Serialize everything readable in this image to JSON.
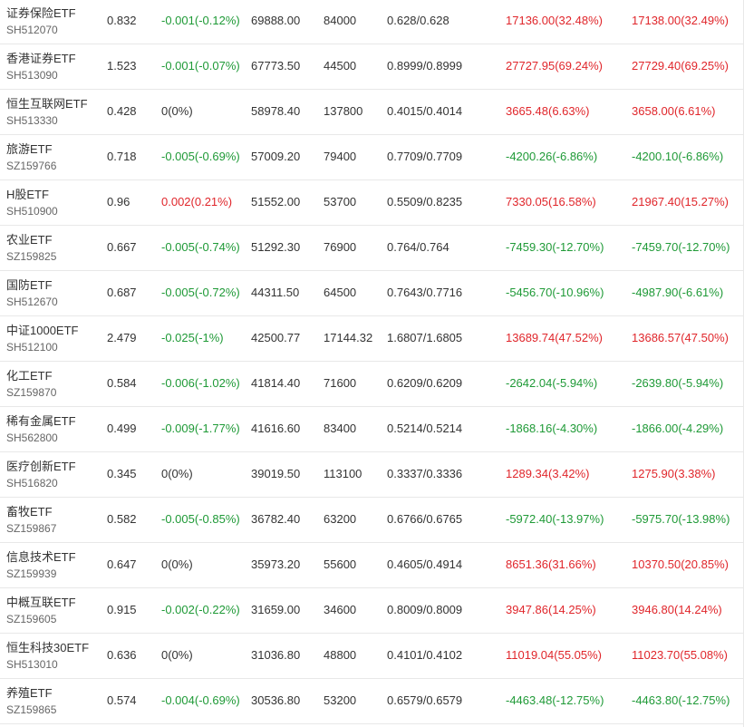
{
  "colors": {
    "up": "#e0262b",
    "down": "#1f9a37",
    "flat": "#333333",
    "code": "#666666",
    "divider": "#e8e8e8"
  },
  "rows": [
    {
      "name": "证券保险ETF",
      "code": "SH512070",
      "price": "0.832",
      "change": "-0.001(-0.12%)",
      "change_dir": "down",
      "c3": "69888.00",
      "c4": "84000",
      "c5": "0.628/0.628",
      "c6": "17136.00(32.48%)",
      "c6_dir": "up",
      "c7": "17138.00(32.49%)",
      "c7_dir": "up"
    },
    {
      "name": "香港证券ETF",
      "code": "SH513090",
      "price": "1.523",
      "change": "-0.001(-0.07%)",
      "change_dir": "down",
      "c3": "67773.50",
      "c4": "44500",
      "c5": "0.8999/0.8999",
      "c6": "27727.95(69.24%)",
      "c6_dir": "up",
      "c7": "27729.40(69.25%)",
      "c7_dir": "up"
    },
    {
      "name": "恒生互联网ETF",
      "code": "SH513330",
      "price": "0.428",
      "change": "0(0%)",
      "change_dir": "flat",
      "c3": "58978.40",
      "c4": "137800",
      "c5": "0.4015/0.4014",
      "c6": "3665.48(6.63%)",
      "c6_dir": "up",
      "c7": "3658.00(6.61%)",
      "c7_dir": "up"
    },
    {
      "name": "旅游ETF",
      "code": "SZ159766",
      "price": "0.718",
      "change": "-0.005(-0.69%)",
      "change_dir": "down",
      "c3": "57009.20",
      "c4": "79400",
      "c5": "0.7709/0.7709",
      "c6": "-4200.26(-6.86%)",
      "c6_dir": "down",
      "c7": "-4200.10(-6.86%)",
      "c7_dir": "down"
    },
    {
      "name": "H股ETF",
      "code": "SH510900",
      "price": "0.96",
      "change": "0.002(0.21%)",
      "change_dir": "up",
      "c3": "51552.00",
      "c4": "53700",
      "c5": "0.5509/0.8235",
      "c6": "7330.05(16.58%)",
      "c6_dir": "up",
      "c7": "21967.40(15.27%)",
      "c7_dir": "up"
    },
    {
      "name": "农业ETF",
      "code": "SZ159825",
      "price": "0.667",
      "change": "-0.005(-0.74%)",
      "change_dir": "down",
      "c3": "51292.30",
      "c4": "76900",
      "c5": "0.764/0.764",
      "c6": "-7459.30(-12.70%)",
      "c6_dir": "down",
      "c7": "-7459.70(-12.70%)",
      "c7_dir": "down"
    },
    {
      "name": "国防ETF",
      "code": "SH512670",
      "price": "0.687",
      "change": "-0.005(-0.72%)",
      "change_dir": "down",
      "c3": "44311.50",
      "c4": "64500",
      "c5": "0.7643/0.7716",
      "c6": "-5456.70(-10.96%)",
      "c6_dir": "down",
      "c7": "-4987.90(-6.61%)",
      "c7_dir": "down"
    },
    {
      "name": "中证1000ETF",
      "code": "SH512100",
      "price": "2.479",
      "change": "-0.025(-1%)",
      "change_dir": "down",
      "c3": "42500.77",
      "c4": "17144.32",
      "c5": "1.6807/1.6805",
      "c6": "13689.74(47.52%)",
      "c6_dir": "up",
      "c7": "13686.57(47.50%)",
      "c7_dir": "up"
    },
    {
      "name": "化工ETF",
      "code": "SZ159870",
      "price": "0.584",
      "change": "-0.006(-1.02%)",
      "change_dir": "down",
      "c3": "41814.40",
      "c4": "71600",
      "c5": "0.6209/0.6209",
      "c6": "-2642.04(-5.94%)",
      "c6_dir": "down",
      "c7": "-2639.80(-5.94%)",
      "c7_dir": "down"
    },
    {
      "name": "稀有金属ETF",
      "code": "SH562800",
      "price": "0.499",
      "change": "-0.009(-1.77%)",
      "change_dir": "down",
      "c3": "41616.60",
      "c4": "83400",
      "c5": "0.5214/0.5214",
      "c6": "-1868.16(-4.30%)",
      "c6_dir": "down",
      "c7": "-1866.00(-4.29%)",
      "c7_dir": "down"
    },
    {
      "name": "医疗创新ETF",
      "code": "SH516820",
      "price": "0.345",
      "change": "0(0%)",
      "change_dir": "flat",
      "c3": "39019.50",
      "c4": "113100",
      "c5": "0.3337/0.3336",
      "c6": "1289.34(3.42%)",
      "c6_dir": "up",
      "c7": "1275.90(3.38%)",
      "c7_dir": "up"
    },
    {
      "name": "畜牧ETF",
      "code": "SZ159867",
      "price": "0.582",
      "change": "-0.005(-0.85%)",
      "change_dir": "down",
      "c3": "36782.40",
      "c4": "63200",
      "c5": "0.6766/0.6765",
      "c6": "-5972.40(-13.97%)",
      "c6_dir": "down",
      "c7": "-5975.70(-13.98%)",
      "c7_dir": "down"
    },
    {
      "name": "信息技术ETF",
      "code": "SZ159939",
      "price": "0.647",
      "change": "0(0%)",
      "change_dir": "flat",
      "c3": "35973.20",
      "c4": "55600",
      "c5": "0.4605/0.4914",
      "c6": "8651.36(31.66%)",
      "c6_dir": "up",
      "c7": "10370.50(20.85%)",
      "c7_dir": "up"
    },
    {
      "name": "中概互联ETF",
      "code": "SZ159605",
      "price": "0.915",
      "change": "-0.002(-0.22%)",
      "change_dir": "down",
      "c3": "31659.00",
      "c4": "34600",
      "c5": "0.8009/0.8009",
      "c6": "3947.86(14.25%)",
      "c6_dir": "up",
      "c7": "3946.80(14.24%)",
      "c7_dir": "up"
    },
    {
      "name": "恒生科技30ETF",
      "code": "SH513010",
      "price": "0.636",
      "change": "0(0%)",
      "change_dir": "flat",
      "c3": "31036.80",
      "c4": "48800",
      "c5": "0.4101/0.4102",
      "c6": "11019.04(55.05%)",
      "c6_dir": "up",
      "c7": "11023.70(55.08%)",
      "c7_dir": "up"
    },
    {
      "name": "养殖ETF",
      "code": "SZ159865",
      "price": "0.574",
      "change": "-0.004(-0.69%)",
      "change_dir": "down",
      "c3": "30536.80",
      "c4": "53200",
      "c5": "0.6579/0.6579",
      "c6": "-4463.48(-12.75%)",
      "c6_dir": "down",
      "c7": "-4463.80(-12.75%)",
      "c7_dir": "down"
    }
  ]
}
